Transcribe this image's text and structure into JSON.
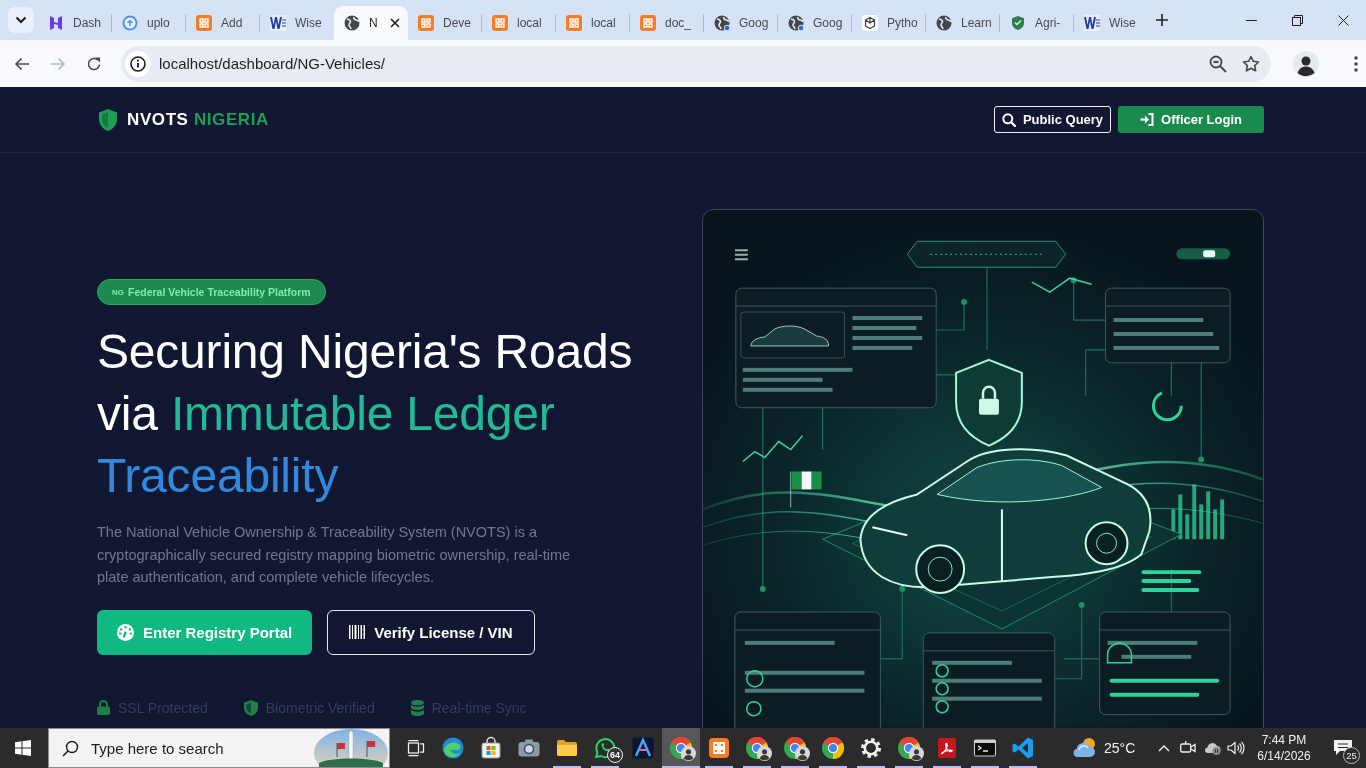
{
  "browser": {
    "tabs": [
      {
        "title": "Dash",
        "kind": "hlogo",
        "selected": false
      },
      {
        "title": "uplo",
        "kind": "disc",
        "selected": false
      },
      {
        "title": "Add",
        "kind": "tile",
        "selected": false
      },
      {
        "title": "Wise",
        "kind": "wlogo",
        "selected": false
      },
      {
        "title": "N",
        "kind": "globe",
        "selected": true
      },
      {
        "title": "Deve",
        "kind": "tile",
        "selected": false
      },
      {
        "title": "local",
        "kind": "tile",
        "selected": false
      },
      {
        "title": "local",
        "kind": "tile",
        "selected": false
      },
      {
        "title": "doc_",
        "kind": "tile",
        "selected": false
      },
      {
        "title": "Goog",
        "kind": "globedot",
        "selected": false
      },
      {
        "title": "Goog",
        "kind": "globedot",
        "selected": false
      },
      {
        "title": "Pytho",
        "kind": "knot",
        "selected": false
      },
      {
        "title": "Learn",
        "kind": "globe",
        "selected": false
      },
      {
        "title": "Agri-",
        "kind": "shield",
        "selected": false
      },
      {
        "title": "Wise",
        "kind": "wlogo",
        "selected": false
      }
    ],
    "forward_disabled": true,
    "url": "localhost/dashboard/NG-Vehicles/",
    "bookmarked": false
  },
  "site": {
    "logo": {
      "name": "NVOTS",
      "accent": "NIGERIA"
    },
    "header_buttons": [
      {
        "label": "Public Query",
        "kind": "outline"
      },
      {
        "label": "Officer Login",
        "kind": "solid"
      }
    ],
    "hero": {
      "badge": {
        "flag": "NG",
        "label": "Federal Vehicle Traceability Platform"
      },
      "heading": [
        {
          "text": "Securing Nigeria's Roads",
          "kind": "plain"
        },
        {
          "text": "via",
          "kind": "plain"
        },
        {
          "text": "Immutable Ledger",
          "kind": "accent"
        },
        {
          "text": "Traceability",
          "kind": "accent2"
        }
      ],
      "description": "The National Vehicle Ownership & Traceability System (NVOTS) is a cryptographically secured registry mapping biometric ownership, real-time plate authentication, and complete vehicle lifecycles.",
      "buttons": [
        {
          "label": "Enter Registry Portal",
          "kind": "solid"
        },
        {
          "label": "Verify License / VIN",
          "kind": "outline"
        }
      ],
      "trust": [
        {
          "label": "SSL Protected",
          "kind": "lock"
        },
        {
          "label": "Biometric Verified",
          "kind": "shield"
        },
        {
          "label": "Real-time Sync",
          "kind": "database"
        }
      ]
    }
  },
  "taskbar": {
    "search": {
      "placeholder": "Type here to search"
    },
    "apps": [
      {
        "kind": "swirl",
        "running": false,
        "selected": false
      },
      {
        "kind": "store",
        "running": false,
        "selected": false
      },
      {
        "kind": "camera",
        "running": false,
        "selected": false
      },
      {
        "kind": "folder",
        "running": true,
        "selected": false
      },
      {
        "kind": "chat",
        "running": true,
        "selected": false,
        "badge": "64"
      },
      {
        "kind": "peak",
        "running": false,
        "selected": false
      },
      {
        "kind": "wheel",
        "running": true,
        "selected": true,
        "profile_badge": true
      },
      {
        "kind": "tile",
        "running": true,
        "selected": false
      },
      {
        "kind": "wheel",
        "running": true,
        "selected": false,
        "profile_badge": true
      },
      {
        "kind": "wheel",
        "running": true,
        "selected": false,
        "profile_badge": true
      },
      {
        "kind": "wheel",
        "running": true,
        "selected": false
      },
      {
        "kind": "gear",
        "running": true,
        "selected": false
      },
      {
        "kind": "wheel",
        "running": true,
        "selected": false,
        "profile_badge": true
      },
      {
        "kind": "document",
        "running": true,
        "selected": false
      },
      {
        "kind": "terminal",
        "running": true,
        "selected": false
      },
      {
        "kind": "code",
        "running": true,
        "selected": false
      }
    ],
    "weather": "25°C",
    "clock": {
      "time": "7:44 PM",
      "date": "6/14/2026"
    },
    "notifications": "25"
  }
}
